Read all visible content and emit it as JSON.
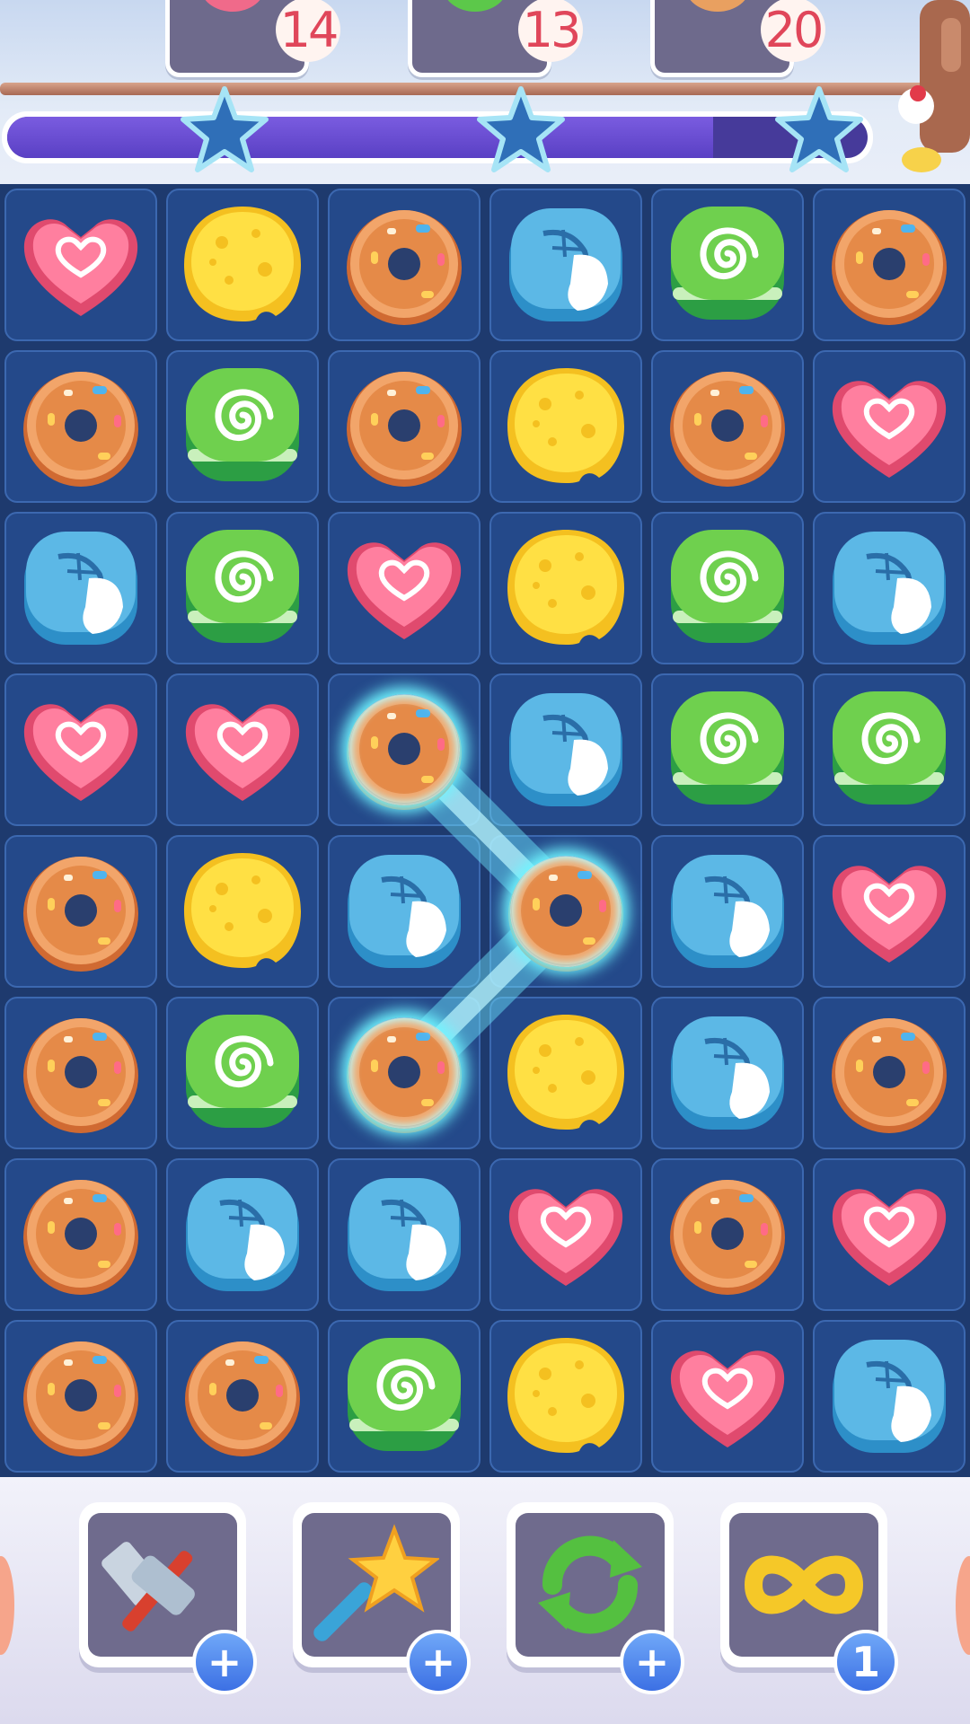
{
  "goals": [
    {
      "piece": "heart",
      "count": "14"
    },
    {
      "piece": "swirl",
      "count": "13"
    },
    {
      "piece": "donut",
      "count": "20"
    }
  ],
  "score_progress": 0.82,
  "stars_earned": 0,
  "stars_total": 3,
  "board": {
    "rows": 8,
    "cols": 6,
    "grid": [
      [
        "heart",
        "cheese",
        "donut",
        "macaron",
        "swirl",
        "donut"
      ],
      [
        "donut",
        "swirl",
        "donut",
        "cheese",
        "donut",
        "heart"
      ],
      [
        "macaron",
        "swirl",
        "heart",
        "cheese",
        "swirl",
        "macaron"
      ],
      [
        "heart",
        "heart",
        "donut",
        "macaron",
        "swirl",
        "swirl"
      ],
      [
        "donut",
        "cheese",
        "macaron",
        "donut",
        "macaron",
        "heart"
      ],
      [
        "donut",
        "swirl",
        "donut",
        "cheese",
        "macaron",
        "donut"
      ],
      [
        "donut",
        "macaron",
        "macaron",
        "heart",
        "donut",
        "heart"
      ],
      [
        "donut",
        "donut",
        "swirl",
        "cheese",
        "heart",
        "macaron"
      ]
    ],
    "selected_chain": [
      [
        3,
        2
      ],
      [
        4,
        3
      ],
      [
        5,
        2
      ]
    ]
  },
  "boosters": [
    {
      "name": "hammer",
      "icon": "hammer-icon",
      "badge": "+"
    },
    {
      "name": "magic-wand",
      "icon": "star-wand-icon",
      "badge": "+"
    },
    {
      "name": "shuffle",
      "icon": "shuffle-icon",
      "badge": "+"
    },
    {
      "name": "infinity",
      "icon": "infinity-icon",
      "badge": "1"
    }
  ],
  "colors": {
    "board_bg": "#1e3a6e",
    "cell_bg": "#24498a",
    "progress": "#5a40c4",
    "badge_text": "#e0465a",
    "booster_badge": "#3c70e4"
  }
}
